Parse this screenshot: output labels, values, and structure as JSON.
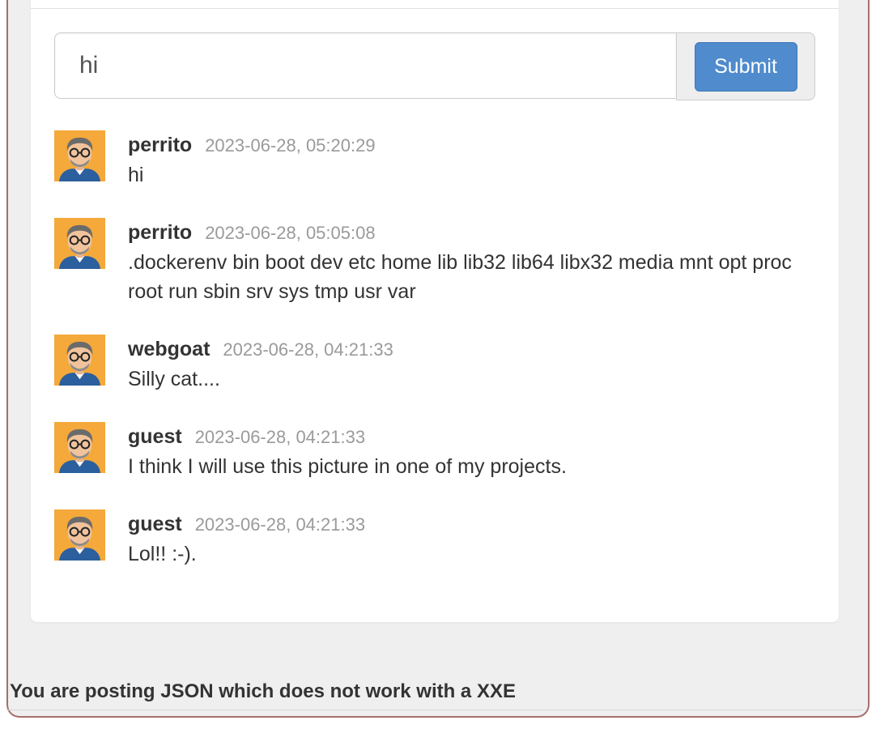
{
  "form": {
    "comment_value": "hi",
    "submit_label": "Submit"
  },
  "comments": [
    {
      "user": "perrito",
      "time": "2023-06-28, 05:20:29",
      "text": "hi"
    },
    {
      "user": "perrito",
      "time": "2023-06-28, 05:05:08",
      "text": ".dockerenv bin boot dev etc home lib lib32 lib64 libx32 media mnt opt proc root run sbin srv sys tmp usr var"
    },
    {
      "user": "webgoat",
      "time": "2023-06-28, 04:21:33",
      "text": "Silly cat...."
    },
    {
      "user": "guest",
      "time": "2023-06-28, 04:21:33",
      "text": "I think I will use this picture in one of my projects."
    },
    {
      "user": "guest",
      "time": "2023-06-28, 04:21:33",
      "text": "Lol!! :-)."
    }
  ],
  "feedback": {
    "message": "You are posting JSON which does not work with a XXE"
  },
  "icons": {
    "avatar": "cartoon-man-with-glasses-avatar"
  },
  "colors": {
    "submit_button": "#4f8bcd",
    "outer_border": "#a86f6f",
    "timestamp": "#9a9a9a"
  }
}
